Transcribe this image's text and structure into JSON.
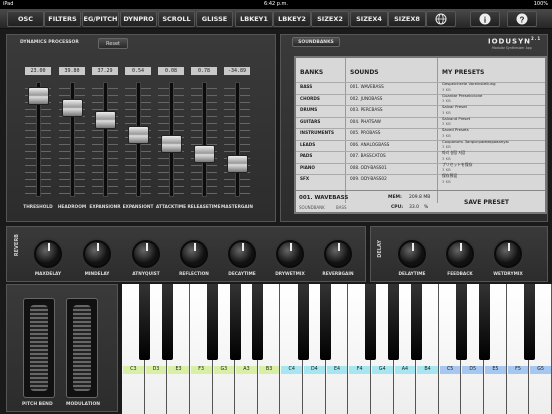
{
  "status": {
    "device": "iPad",
    "time": "6:42 p.m.",
    "battery": "100%"
  },
  "topbar": {
    "buttons": [
      "OSC",
      "FILTERS",
      "EG/PITCH",
      "DYNPRO",
      "SCROLL",
      "GLISSE",
      "LBKEY1",
      "LBKEY2",
      "SIZEX2",
      "SIZEX4",
      "SIZEX8"
    ]
  },
  "icons": {
    "globe": "globe-icon",
    "info": "info-icon",
    "help": "help-icon"
  },
  "dynamics": {
    "title": "DYNAMICS PROCESSOR",
    "reset": "Reset",
    "values": [
      "23.00",
      "39.80",
      "37.29",
      "0.54",
      "0.08",
      "0.78",
      "-34.89"
    ],
    "labels": [
      "THRESHOLD",
      "HEADROOM",
      "EXPANSIONR",
      "EXPANSIONT",
      "ATTACKTIME",
      "RELEASETIME",
      "MASTERGAIN"
    ],
    "levels": [
      0.95,
      0.82,
      0.7,
      0.55,
      0.45,
      0.35,
      0.25
    ]
  },
  "soundbanks": {
    "title": "SOUNDBANKS",
    "brand": "IODUSYN",
    "brand_sup": "2.1",
    "brand_sub": "Modular Synthesizer App",
    "headers": {
      "banks": "BANKS",
      "sounds": "SOUNDS",
      "presets": "MY PRESETS"
    },
    "banks": [
      "BASS",
      "CHORDS",
      "DRUMS",
      "GUITARS",
      "INSTRUMENTS",
      "LEADS",
      "PADS",
      "PIANO",
      "SFX"
    ],
    "sounds": [
      "001. WAVEBASS",
      "002. JUNOBASS",
      "003. PERCBASS",
      "004. PHATSAW",
      "005. PROBASS",
      "006. ANALOGBASS",
      "007. BASSCATOS",
      "008. ODY-BASS01",
      "009. ODY-BASS02"
    ],
    "presets": [
      {
        "name": "Gespeicherte Voreinstellung",
        "size": "3 KB"
      },
      {
        "name": "Guardar Preselccione",
        "size": "3 KB"
      },
      {
        "name": "Salvar Preset",
        "size": "3 KB"
      },
      {
        "name": "Salvand Preset",
        "size": "3 KB"
      },
      {
        "name": "Saved Presets",
        "size": "3 KB"
      },
      {
        "name": "Сохранить Запрограммированую",
        "size": "3 KB"
      },
      {
        "name": "파리 설정 저장",
        "size": "3 KB"
      },
      {
        "name": "プリセットを保存",
        "size": "3 KB"
      },
      {
        "name": "保存预设",
        "size": "3 KB"
      }
    ],
    "current": "001. WAVEBASS",
    "mem_label": "MEM:",
    "mem_value": "209.8 MB",
    "cpu_label": "CPU:",
    "cpu_value": "33.0",
    "cpu_unit": "%",
    "bank_label": "SOUNDBANK",
    "bank_value": "BASS",
    "save": "SAVE PRESET"
  },
  "reverb": {
    "section": "REVERB",
    "knobs": [
      "MAXDELAY",
      "MINDELAY",
      "ATNYQUIST",
      "REFLECTION",
      "DECAYTIME",
      "DRYWETMIX",
      "REVERBGAIN"
    ]
  },
  "delay": {
    "section": "DELAY",
    "knobs": [
      "DELAYTIME",
      "FEEDBACK",
      "WETDRYMIX"
    ]
  },
  "wheels": {
    "pitch": "PITCH BEND",
    "mod": "MODULATION"
  },
  "keyboard": {
    "notes": [
      "C3",
      "D3",
      "E3",
      "F3",
      "G3",
      "A3",
      "B3",
      "C4",
      "D4",
      "E4",
      "F4",
      "G4",
      "A4",
      "B4",
      "C5",
      "D5",
      "E5",
      "F5",
      "G5"
    ],
    "note_colors": [
      "#d7f0a6",
      "#d7f0a6",
      "#d7f0a6",
      "#d7f0a6",
      "#d7f0a6",
      "#d7f0a6",
      "#d7f0a6",
      "#a6e6f0",
      "#a6e6f0",
      "#a6e6f0",
      "#a6e6f0",
      "#a6e6f0",
      "#a6e6f0",
      "#a6e6f0",
      "#a6c8f0",
      "#a6c8f0",
      "#a6c8f0",
      "#a6c8f0",
      "#a6c8f0"
    ]
  }
}
